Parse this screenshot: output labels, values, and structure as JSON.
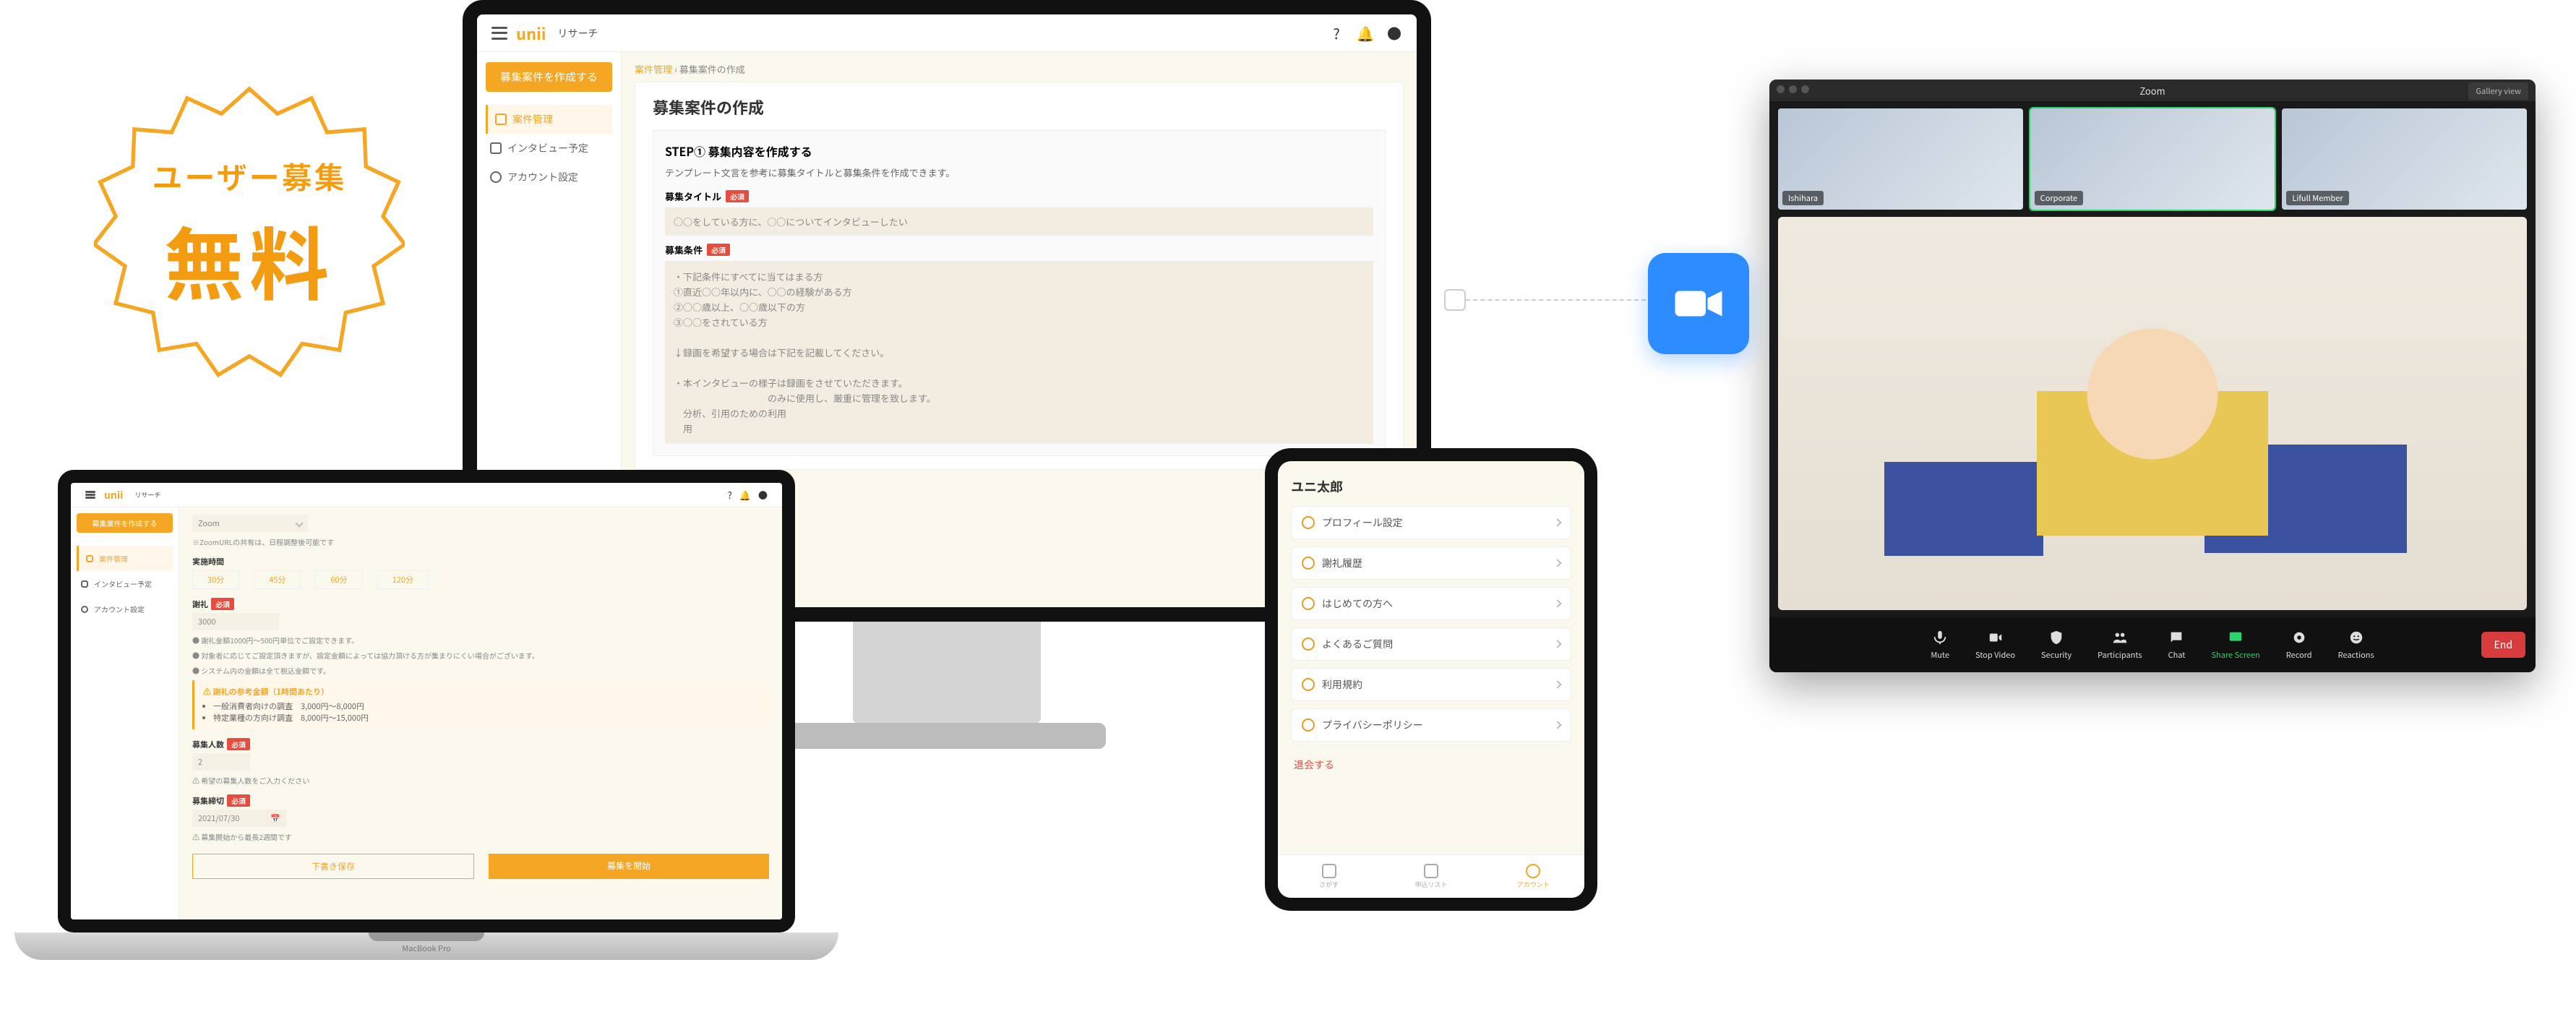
{
  "badge": {
    "line1": "ユーザー募集",
    "line2": "無料"
  },
  "imac_app": {
    "logo": "unii",
    "logo_sub": "リサーチ",
    "breadcrumb_root": "案件管理",
    "breadcrumb_current": "募集案件の作成",
    "page_title": "募集案件の作成",
    "sidebar": {
      "primary": "募集案件を作成する",
      "items": [
        "案件管理",
        "インタビュー予定",
        "アカウント設定"
      ]
    },
    "step": {
      "title": "STEP① 募集内容を作成する",
      "desc": "テンプレート文言を参考に募集タイトルと募集条件を作成できます。",
      "title_label": "募集タイトル",
      "required": "必須",
      "title_placeholder": "○○をしている方に、○○についてインタビューしたい",
      "cond_label": "募集条件",
      "cond_lines": [
        "・下記条件にすべてに当てはまる方",
        "①直近○○年以内に、○○の経験がある方",
        "②○○歳以上、○○歳以下の方",
        "③○○をされている方",
        "",
        "↓録画を希望する場合は下記を記載してください。",
        "",
        "・本インタビューの様子は録画をさせていただきます。",
        "　　　　　　　　　　のみに使用し、厳重に管理を致します。",
        "　分析、引用のための利用",
        "　用"
      ]
    }
  },
  "laptop_app": {
    "zoom_select": "Zoom",
    "zoom_note": "※ZoomURLの共有は、日程調整後可能です",
    "time_label": "実施時間",
    "times": [
      "30分",
      "45分",
      "60分",
      "120分"
    ],
    "reward_label": "謝礼",
    "reward_value": "3000",
    "reward_notes": [
      "● 謝礼金額1000円〜500円単位でご設定できます。",
      "● 対象者に応じてご設定頂きますが、設定金額によっては協力頂ける方が集まりにくい場合がございます。",
      "● システム内の金額は全て税込金額です。"
    ],
    "tip_title": "謝礼の参考金額（1時間あたり）",
    "tip_lines": [
      "一般消費者向けの調査　3,000円〜8,000円",
      "特定業種の方向け調査　8,000円〜15,000円"
    ],
    "people_label": "募集人数",
    "people_value": "2",
    "people_note": "⚠ 希望の募集人数をご入力ください",
    "deadline_label": "募集締切",
    "deadline_value": "2021/07/30",
    "deadline_note": "⚠ 募集開始から最長2週間です",
    "btn_draft": "下書き保存",
    "btn_start": "募集を開始",
    "model": "MacBook Pro"
  },
  "ipad": {
    "user": "ユニ太郎",
    "menu": [
      "プロフィール設定",
      "謝礼履歴",
      "はじめての方へ",
      "よくあるご質問",
      "利用規約",
      "プライバシーポリシー"
    ],
    "logout": "退会する",
    "tabs": [
      "さがす",
      "申込リスト",
      "アカウント"
    ]
  },
  "zoom": {
    "title": "Zoom",
    "gallery": "Gallery view",
    "thumbs": [
      "Ishihara",
      "Corporate",
      "Lifull Member"
    ],
    "toolbar": [
      "Mute",
      "Stop Video",
      "Security",
      "Participants",
      "Chat",
      "Share Screen",
      "Record",
      "Reactions"
    ],
    "end": "End"
  }
}
